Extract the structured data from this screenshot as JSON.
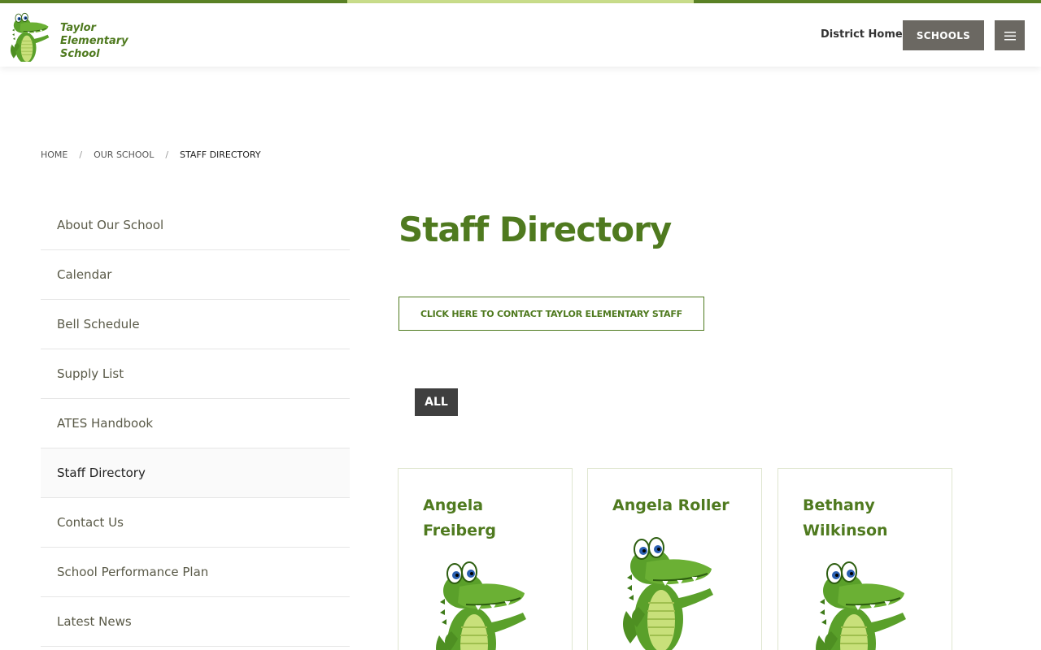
{
  "header": {
    "school_name": "Taylor Elementary School",
    "district_home": "District Home",
    "schools_label": "SCHOOLS"
  },
  "breadcrumb": [
    {
      "label": "HOME"
    },
    {
      "label": "OUR SCHOOL"
    },
    {
      "label": "STAFF DIRECTORY"
    }
  ],
  "sidenav": {
    "items": [
      {
        "label": "About Our School"
      },
      {
        "label": "Calendar"
      },
      {
        "label": "Bell Schedule"
      },
      {
        "label": "Supply List"
      },
      {
        "label": "ATES Handbook"
      },
      {
        "label": "Staff Directory"
      },
      {
        "label": "Contact Us"
      },
      {
        "label": "School Performance Plan"
      },
      {
        "label": "Latest News"
      }
    ]
  },
  "main": {
    "title": "Staff Directory",
    "contact_button": "CLICK HERE TO CONTACT TAYLOR ELEMENTARY STAFF",
    "filter_all": "ALL"
  },
  "staff": [
    {
      "name": "Angela Freiberg"
    },
    {
      "name": "Angela Roller"
    },
    {
      "name": "Bethany Wilkinson"
    }
  ],
  "colors": {
    "brand_green": "#4f7a1f",
    "accent_light_green": "#c9dd8a",
    "button_gray": "#6b6862",
    "filter_dark": "#3f3f3f"
  }
}
